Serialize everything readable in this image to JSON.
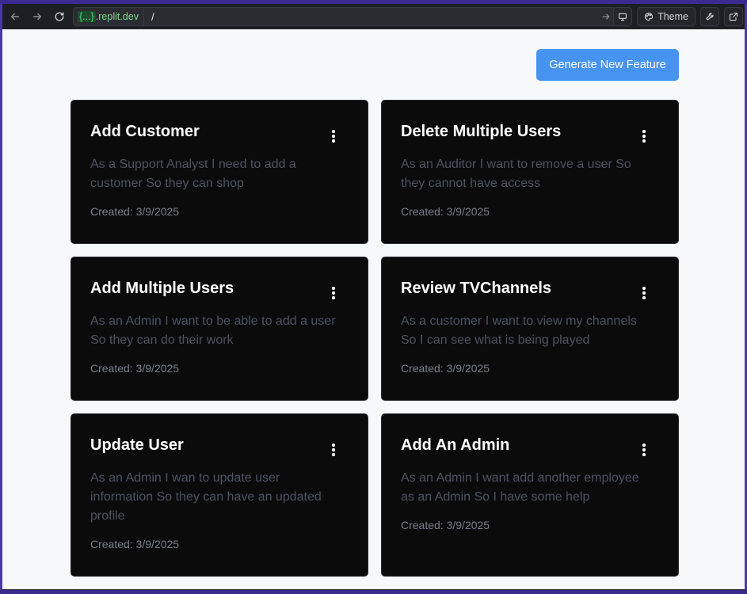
{
  "browser": {
    "url_domain_brace": "{...}",
    "url_domain_suffix": ".replit.dev",
    "url_path": "/",
    "theme_label": "Theme"
  },
  "page": {
    "generate_button": "Generate New Feature"
  },
  "features": [
    {
      "title": "Add Customer",
      "description": "As a Support Analyst I need to add a customer So they can shop",
      "created": "Created: 3/9/2025"
    },
    {
      "title": "Delete Multiple Users",
      "description": "As an Auditor I want to remove a user So they cannot have access",
      "created": "Created: 3/9/2025"
    },
    {
      "title": "Add Multiple Users",
      "description": "As an Admin I want to be able to add a user So they can do their work",
      "created": "Created: 3/9/2025"
    },
    {
      "title": "Review TVChannels",
      "description": "As a customer I want to view my channels So I can see what is being played",
      "created": "Created: 3/9/2025"
    },
    {
      "title": "Update User",
      "description": "As an Admin I wan to update user information So they can have an updated profile",
      "created": "Created: 3/9/2025"
    },
    {
      "title": "Add An Admin",
      "description": "As an Admin I want add another employee as an Admin So I have some help",
      "created": "Created: 3/9/2025"
    }
  ]
}
